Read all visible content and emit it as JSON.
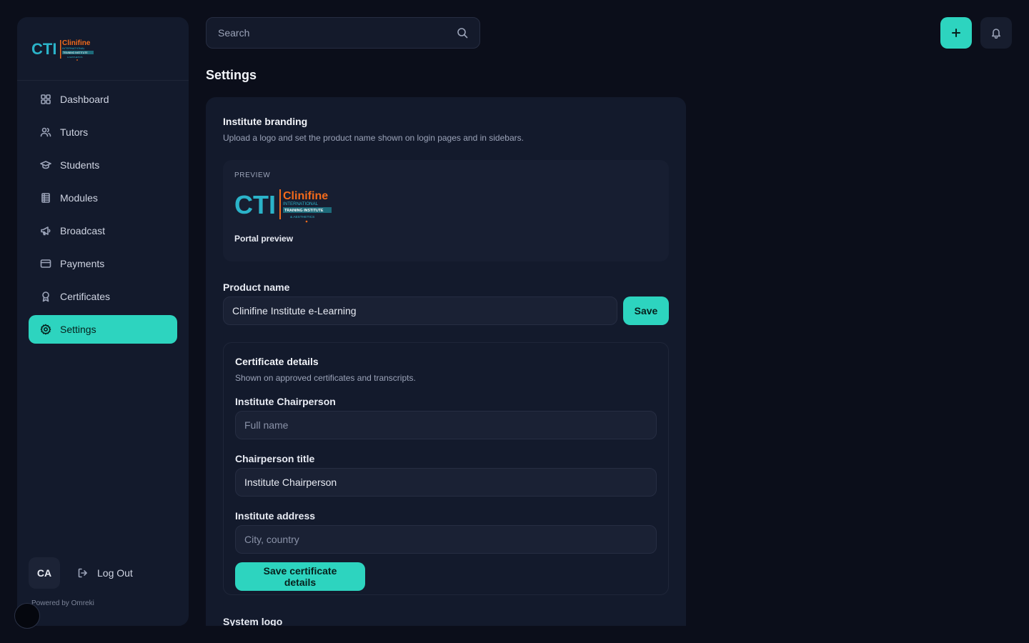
{
  "brand": {
    "logo_letters": "CTI",
    "logo_name": "Clinifine",
    "logo_sub1": "INTERNATIONAL",
    "logo_sub2": "TRAINING INSTITUTE",
    "logo_sub3": "& AESTHETICS",
    "accent": "#2dd4bf",
    "logo_teal": "#2bb3c9",
    "logo_orange": "#f26a1b"
  },
  "sidebar": {
    "items": [
      {
        "label": "Dashboard",
        "icon": "grid-icon"
      },
      {
        "label": "Tutors",
        "icon": "users-icon"
      },
      {
        "label": "Students",
        "icon": "graduation-cap-icon"
      },
      {
        "label": "Modules",
        "icon": "library-icon"
      },
      {
        "label": "Broadcast",
        "icon": "megaphone-icon"
      },
      {
        "label": "Payments",
        "icon": "credit-card-icon"
      },
      {
        "label": "Certificates",
        "icon": "award-icon"
      },
      {
        "label": "Settings",
        "icon": "gear-icon",
        "active": true
      }
    ],
    "avatar_initials": "CA",
    "logout_label": "Log Out",
    "powered_by": "Powered by Omreki"
  },
  "header": {
    "search_placeholder": "Search"
  },
  "page": {
    "title": "Settings"
  },
  "branding": {
    "title": "Institute branding",
    "description": "Upload a logo and set the product name shown on login pages and in sidebars.",
    "preview_label": "PREVIEW",
    "preview_caption": "Portal preview",
    "product_name_label": "Product name",
    "product_name_value": "Clinifine Institute e-Learning",
    "save_label": "Save"
  },
  "certificate": {
    "title": "Certificate details",
    "description": "Shown on approved certificates and transcripts.",
    "chairperson_label": "Institute Chairperson",
    "chairperson_placeholder": "Full name",
    "title_label": "Chairperson title",
    "title_value": "Institute Chairperson",
    "address_label": "Institute address",
    "address_placeholder": "City, country",
    "save_label": "Save certificate details"
  },
  "system_logo": {
    "title": "System logo"
  }
}
